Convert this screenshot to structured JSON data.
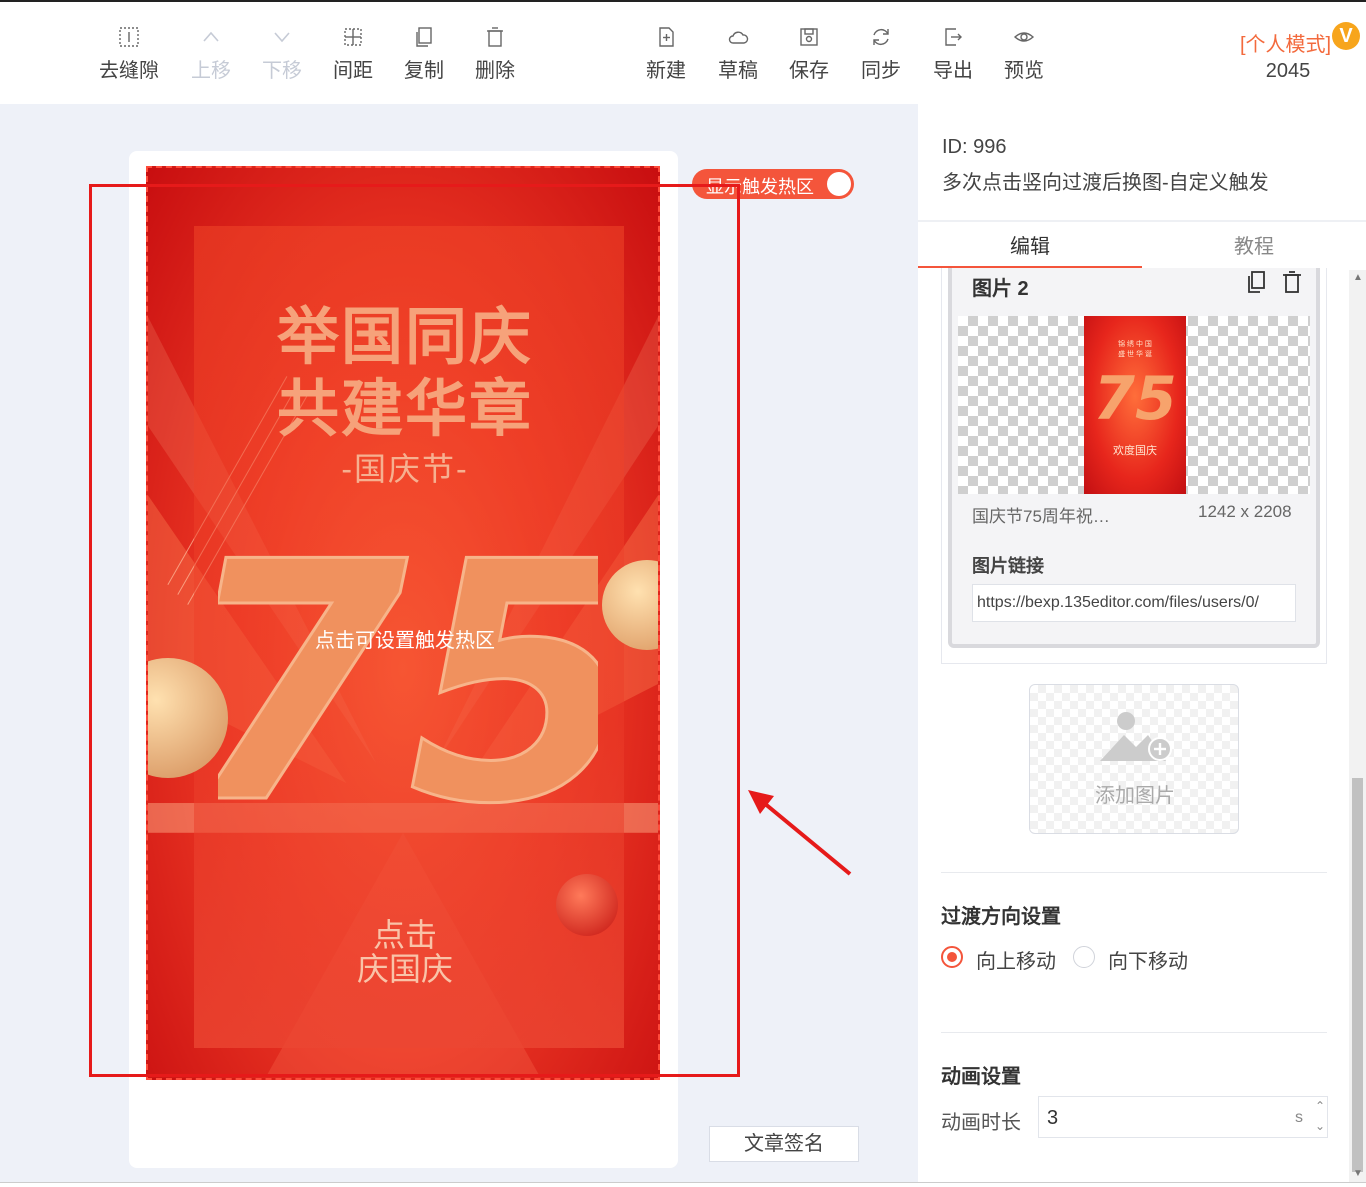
{
  "toolbar": {
    "left_tools": [
      {
        "label": "去缝隙",
        "icon": "gap-icon",
        "enabled": true
      },
      {
        "label": "上移",
        "icon": "chevron-up-icon",
        "enabled": false
      },
      {
        "label": "下移",
        "icon": "chevron-down-icon",
        "enabled": false
      },
      {
        "label": "间距",
        "icon": "spacing-icon",
        "enabled": true
      },
      {
        "label": "复制",
        "icon": "copy-icon",
        "enabled": true
      },
      {
        "label": "删除",
        "icon": "trash-icon",
        "enabled": true
      }
    ],
    "right_tools": [
      {
        "label": "新建",
        "icon": "new-file-icon"
      },
      {
        "label": "草稿",
        "icon": "cloud-icon"
      },
      {
        "label": "保存",
        "icon": "save-icon"
      },
      {
        "label": "同步",
        "icon": "sync-icon"
      },
      {
        "label": "导出",
        "icon": "export-icon"
      },
      {
        "label": "预览",
        "icon": "eye-icon"
      }
    ],
    "mode_label": "[个人模式]",
    "mode_badge": "V",
    "mode_number": "2045"
  },
  "canvas": {
    "poster": {
      "title_line1": "举国同庆",
      "title_line2": "共建华章",
      "subtitle": "-国庆节-",
      "big_number": "75",
      "hint": "点击可设置触发热区",
      "button_line1": "点击",
      "button_line2": "庆国庆"
    },
    "hotzone_toggle_label": "显示触发热区",
    "signature_button": "文章签名"
  },
  "panel": {
    "template_id": "ID: 996",
    "template_name": "多次点击竖向过渡后换图-自定义触发",
    "tabs": [
      "编辑",
      "教程"
    ],
    "image_card": {
      "title": "图片 2",
      "thumb_small_text": "锦 绣 中 国\n盛 世 华 诞",
      "thumb_number": "75",
      "thumb_text": "欢度国庆",
      "name": "国庆节75周年祝…",
      "size": "1242 x 2208",
      "link_label": "图片链接",
      "link_value": "https://bexp.135editor.com/files/users/0/"
    },
    "add_image_label": "添加图片",
    "transition": {
      "title": "过渡方向设置",
      "options": [
        "向上移动",
        "向下移动"
      ],
      "selected": 0
    },
    "animation": {
      "title": "动画设置",
      "duration_label": "动画时长",
      "duration_value": "3",
      "unit": "s"
    }
  },
  "colors": {
    "accent": "#f4553b",
    "annotation_red": "#e61a1a",
    "canvas_bg": "#eef1f8"
  }
}
